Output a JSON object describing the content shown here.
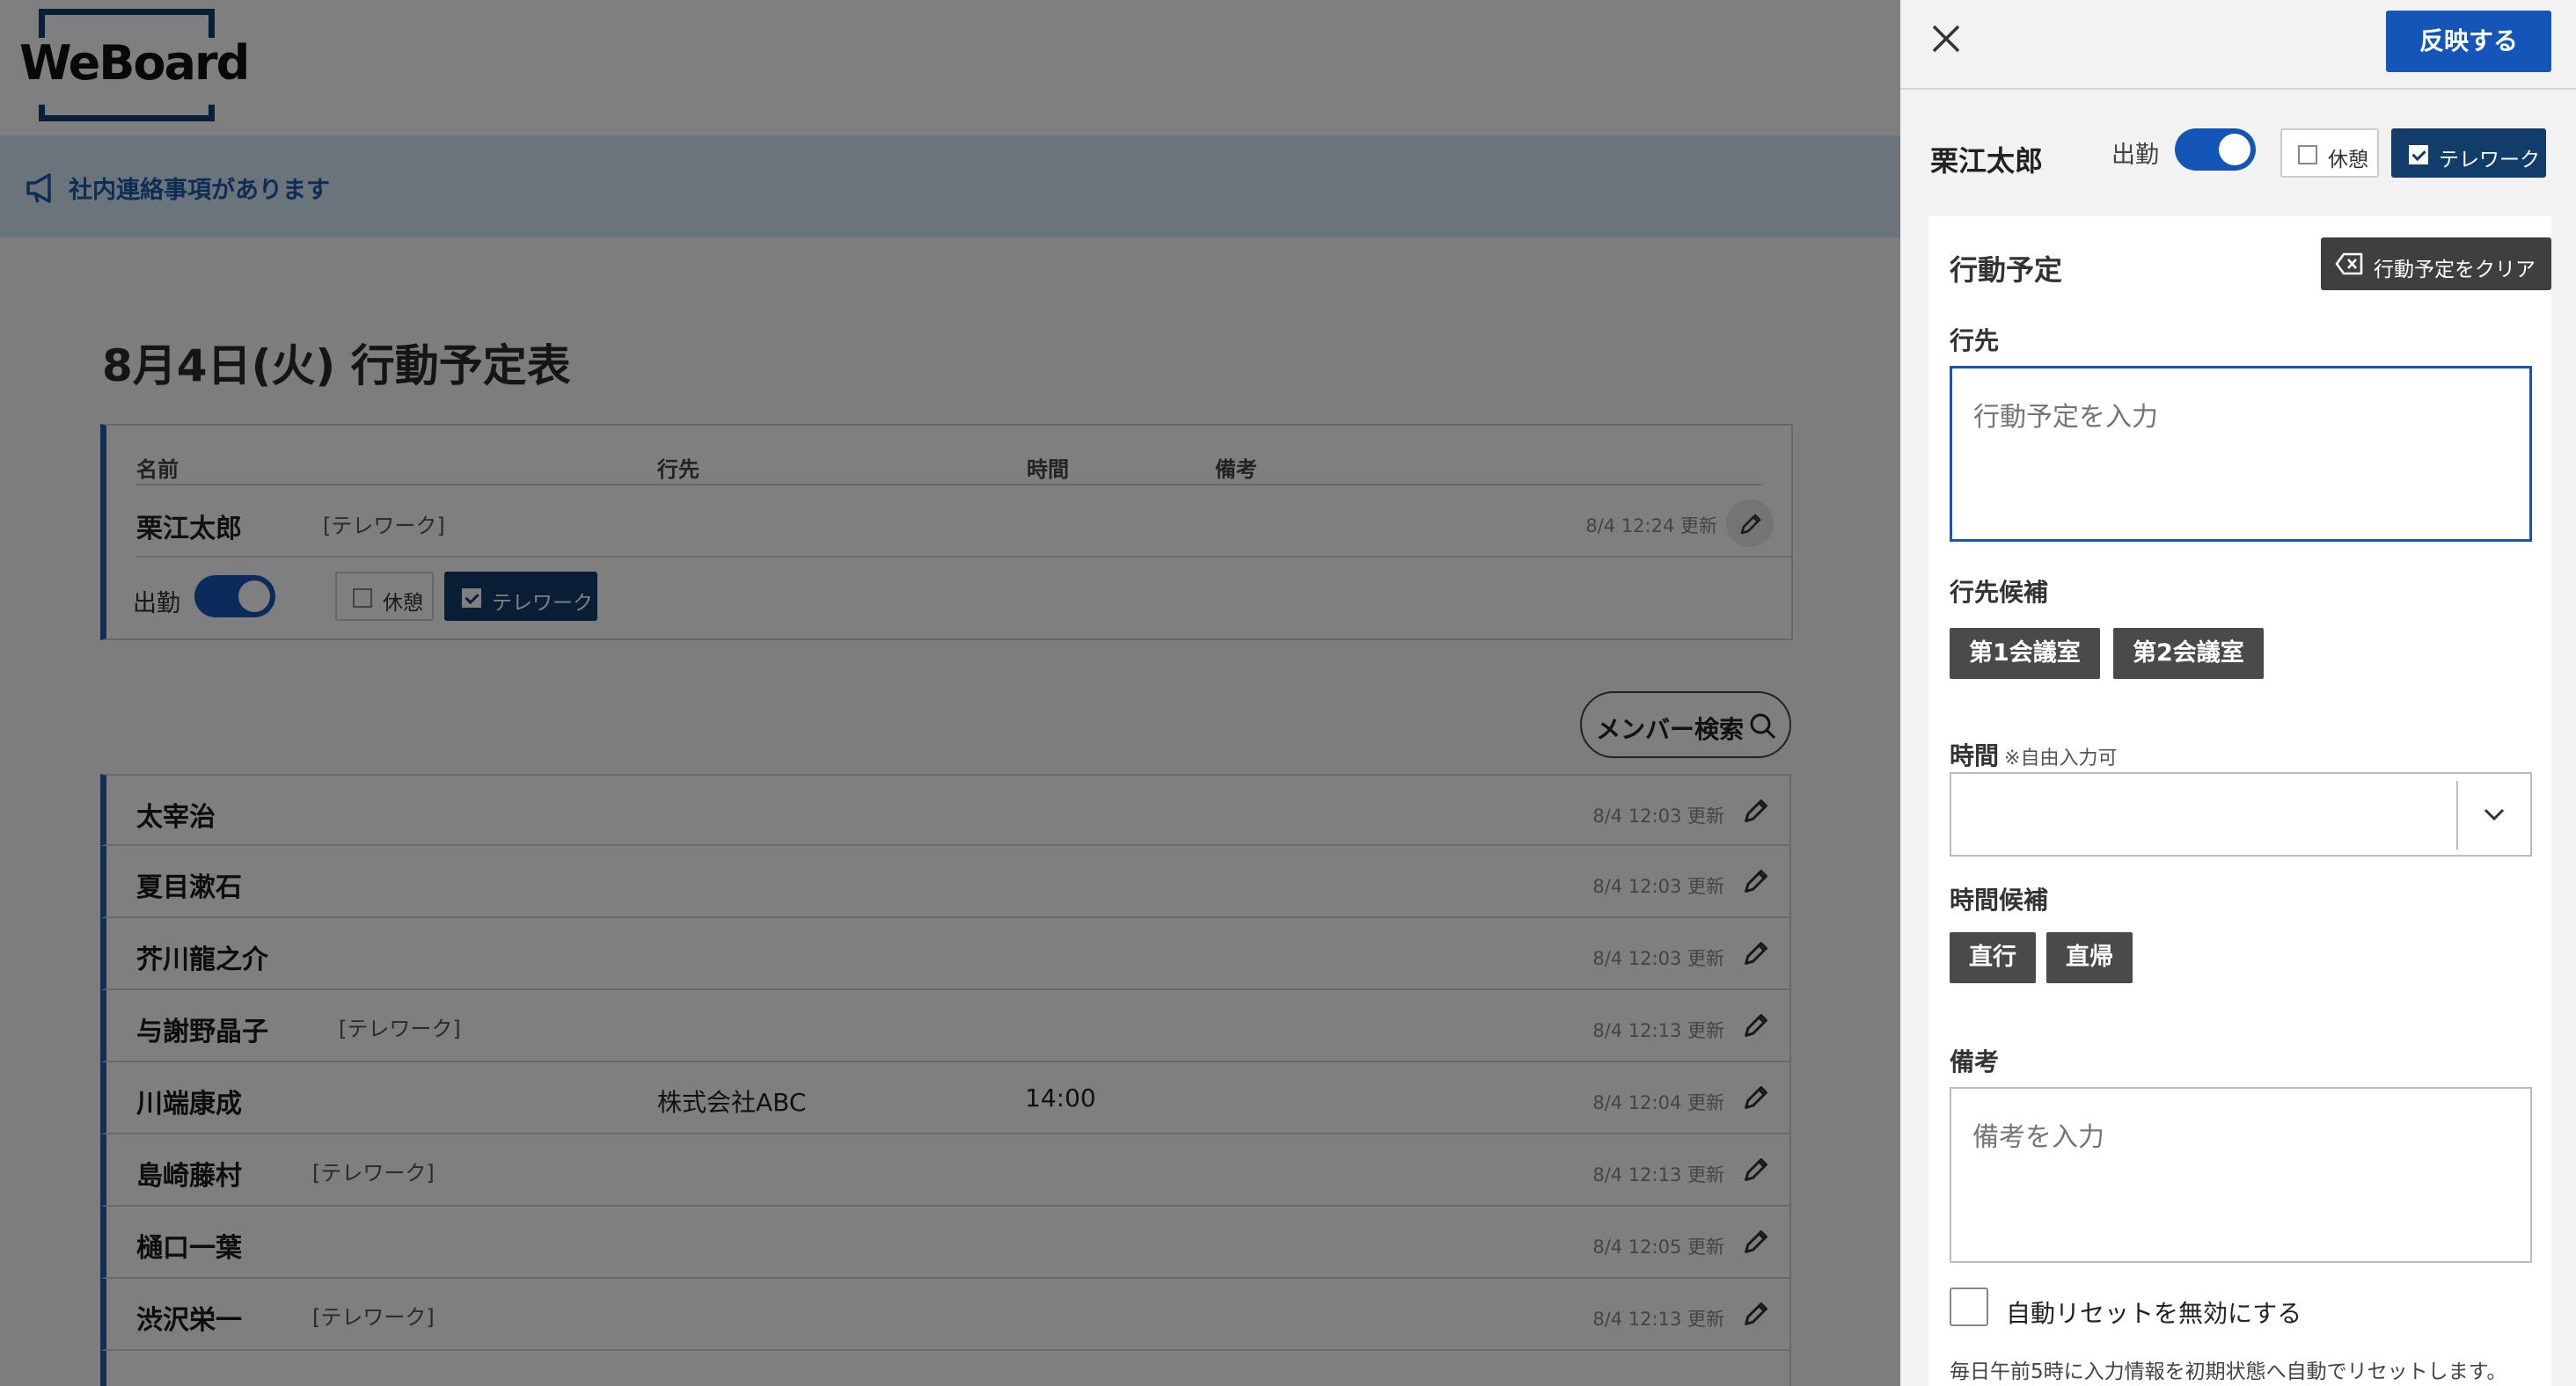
{
  "app": {
    "logo_text": "WeBoard"
  },
  "notice": {
    "text": "社内連絡事項があります"
  },
  "schedule": {
    "title": "8月4日(火) 行動予定表",
    "columns": {
      "name": "名前",
      "destination": "行先",
      "time": "時間",
      "remarks": "備考"
    },
    "me": {
      "name": "栗江太郎",
      "tag": "[テレワーク]",
      "updated": "8/4 12:24 更新",
      "attend_label": "出勤",
      "break_label": "休憩",
      "telework_label": "テレワーク"
    },
    "member_search_label": "メンバー検索",
    "members": [
      {
        "name": "太宰治",
        "tag": "",
        "destination": "",
        "time": "",
        "updated": "8/4 12:03 更新"
      },
      {
        "name": "夏目漱石",
        "tag": "",
        "destination": "",
        "time": "",
        "updated": "8/4 12:03 更新"
      },
      {
        "name": "芥川龍之介",
        "tag": "",
        "destination": "",
        "time": "",
        "updated": "8/4 12:03 更新"
      },
      {
        "name": "与謝野晶子",
        "tag": "[テレワーク]",
        "destination": "",
        "time": "",
        "updated": "8/4 12:13 更新"
      },
      {
        "name": "川端康成",
        "tag": "",
        "destination": "株式会社ABC",
        "time": "14:00",
        "updated": "8/4 12:04 更新"
      },
      {
        "name": "島崎藤村",
        "tag": "[テレワーク]",
        "destination": "",
        "time": "",
        "updated": "8/4 12:13 更新"
      },
      {
        "name": "樋口一葉",
        "tag": "",
        "destination": "",
        "time": "",
        "updated": "8/4 12:05 更新"
      },
      {
        "name": "渋沢栄一",
        "tag": "[テレワーク]",
        "destination": "",
        "time": "",
        "updated": "8/4 12:13 更新"
      }
    ]
  },
  "panel": {
    "apply_label": "反映する",
    "user_name": "栗江太郎",
    "attend_label": "出勤",
    "break_label": "休憩",
    "telework_label": "テレワーク",
    "section_title": "行動予定",
    "clear_label": "行動予定をクリア",
    "destination_label": "行先",
    "destination_placeholder": "行動予定を入力",
    "destination_candidates_label": "行先候補",
    "destination_candidates": [
      "第1会議室",
      "第2会議室"
    ],
    "time_label": "時間",
    "time_note": "※自由入力可",
    "time_value": "",
    "time_candidates_label": "時間候補",
    "time_candidates": [
      "直行",
      "直帰"
    ],
    "remarks_label": "備考",
    "remarks_placeholder": "備考を入力",
    "auto_reset_label": "自動リセットを無効にする",
    "auto_reset_checked": false,
    "auto_reset_note": "毎日午前5時に入力情報を初期状態へ自動でリセットします。"
  },
  "colors": {
    "accent": "#1456b8",
    "dark_chip": "#123d6b",
    "candidate": "#4a4a4a",
    "notice_bg": "#d9e8f7"
  }
}
